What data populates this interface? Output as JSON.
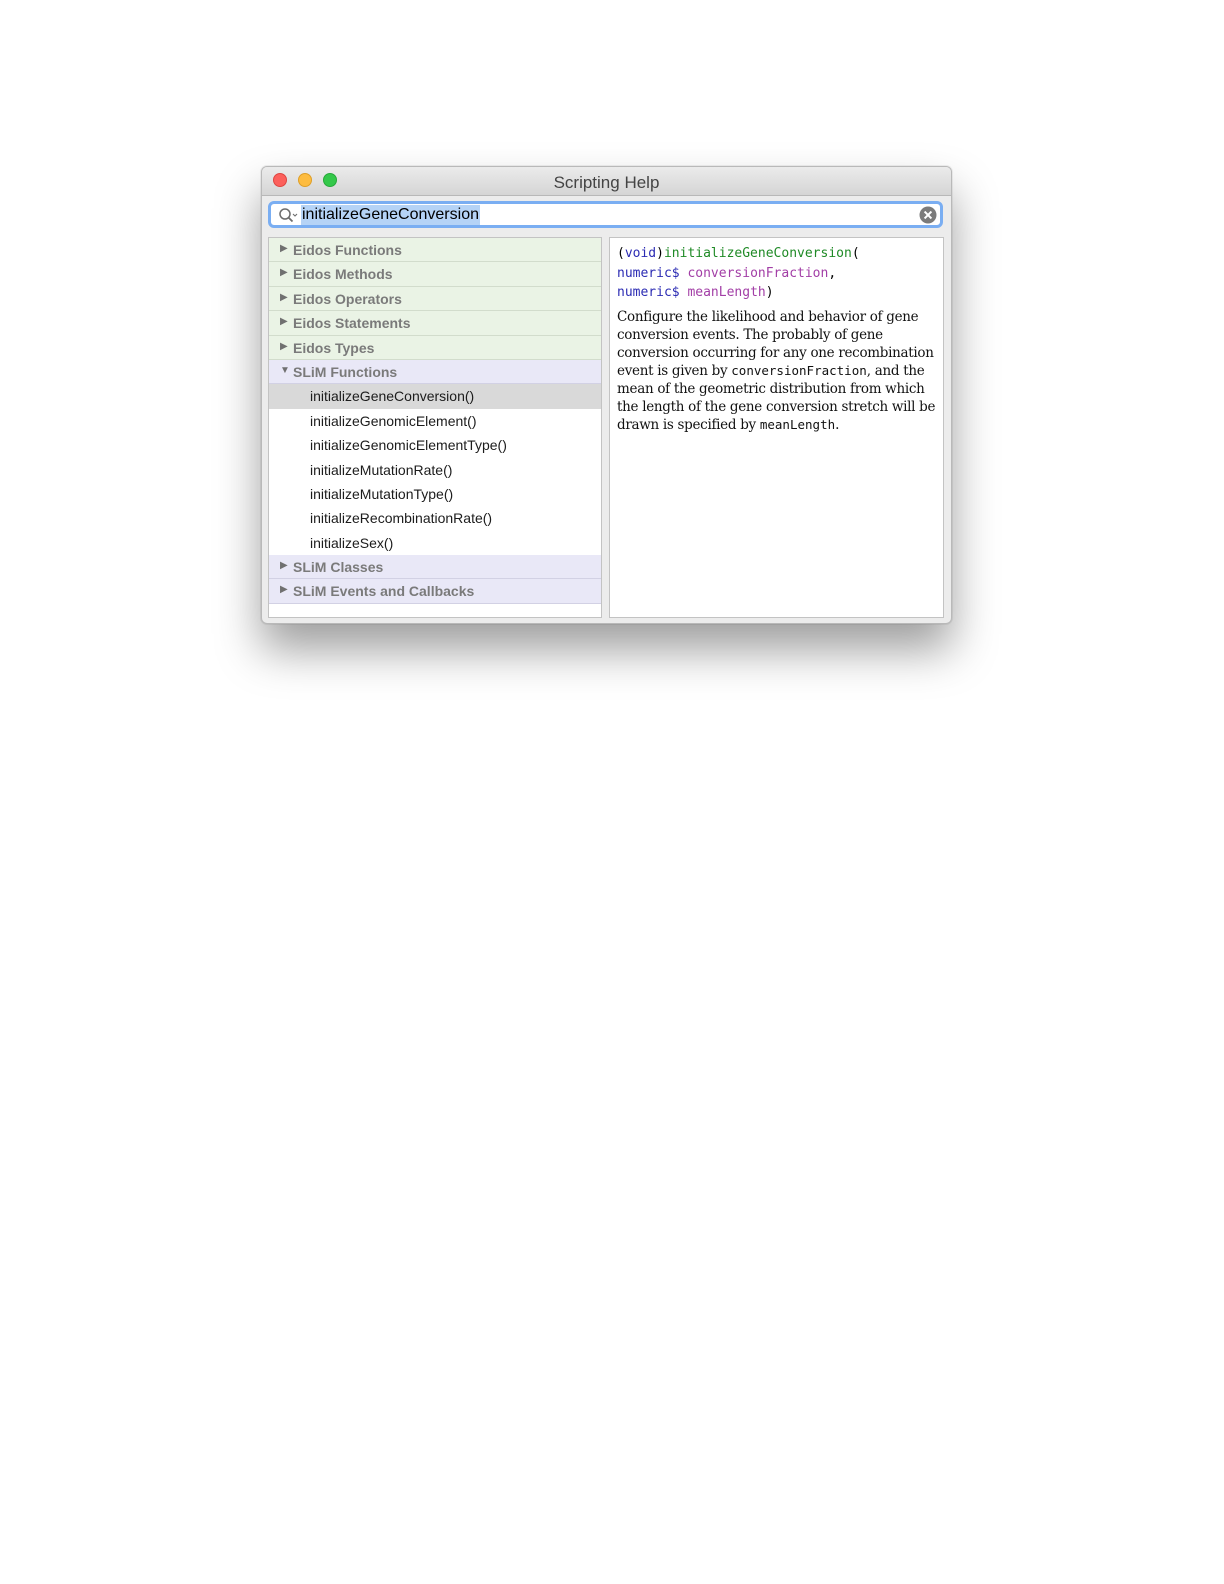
{
  "window": {
    "title": "Scripting Help"
  },
  "search": {
    "value": "initializeGeneConversion"
  },
  "outline": {
    "eidos_categories": [
      {
        "label": "Eidos Functions"
      },
      {
        "label": "Eidos Methods"
      },
      {
        "label": "Eidos Operators"
      },
      {
        "label": "Eidos Statements"
      },
      {
        "label": "Eidos Types"
      }
    ],
    "slim_functions": {
      "label": "SLiM Functions",
      "items": [
        "initializeGeneConversion()",
        "initializeGenomicElement()",
        "initializeGenomicElementType()",
        "initializeMutationRate()",
        "initializeMutationType()",
        "initializeRecombinationRate()",
        "initializeSex()"
      ],
      "selected_index": 0
    },
    "slim_categories": [
      {
        "label": "SLiM Classes"
      },
      {
        "label": "SLiM Events and Callbacks"
      }
    ]
  },
  "detail": {
    "sig": {
      "open": "(",
      "return_type": "void",
      "close": ")",
      "name": "initializeGeneConversion",
      "paren_open": "(",
      "type1": "numeric$",
      "param1": "conversionFraction",
      "comma": ",",
      "type2": "numeric$",
      "param2": "meanLength",
      "paren_close": ")"
    },
    "desc": {
      "text1": "Configure the likelihood and behavior of gene conversion events.  The probably of gene conversion occurring for any one recombination event is given by ",
      "code1": "conversionFraction",
      "text2": ", and the mean of the geometric distribution from which the length of the gene conversion stretch will be drawn is specified by ",
      "code2": "meanLength",
      "text3": "."
    }
  },
  "colors": {
    "eidos_row": "#eaf3e5",
    "slim_row": "#e9e8f7",
    "keyword": "#2b2bb3",
    "function_name": "#1f8a26",
    "parameter": "#a23ea6",
    "search_focus": "#7aaef2",
    "link": "#1a35c0"
  }
}
